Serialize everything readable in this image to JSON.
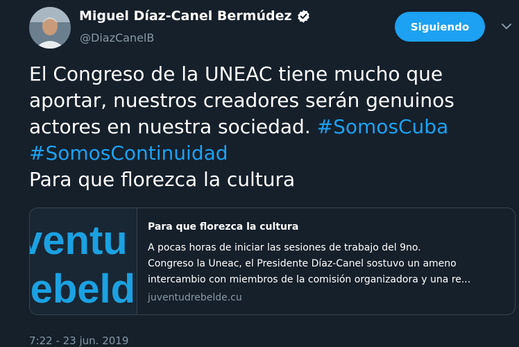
{
  "author": {
    "name": "Miguel Díaz-Canel Bermúdez",
    "handle": "@DiazCanelB",
    "verified": true
  },
  "follow_button": {
    "label": "Siguiendo"
  },
  "tweet": {
    "lines": [
      [
        {
          "text": "El Congreso de  la UNEAC tiene mucho que",
          "hashtag": false
        }
      ],
      [
        {
          "text": "aportar, nuestros creadores serán genuinos",
          "hashtag": false
        }
      ],
      [
        {
          "text": "actores en nuestra sociedad. ",
          "hashtag": false
        },
        {
          "text": "#SomosCuba",
          "hashtag": true
        }
      ],
      [
        {
          "text": "#SomosContinuidad",
          "hashtag": true
        }
      ],
      [
        {
          "text": "Para que florezca la cultura",
          "hashtag": false
        }
      ]
    ]
  },
  "link_card": {
    "thumbnail_text": [
      "ventu",
      "rebeld"
    ],
    "title": "Para que florezca la cultura",
    "description_lines": [
      "A pocas horas de iniciar las sesiones de trabajo del 9no.",
      "Congreso la Uneac, el Presidente Díaz-Canel sostuvo un ameno",
      "intercambio con miembros de la comisión organizadora y una re..."
    ],
    "domain": "juventudrebelde.cu"
  },
  "timestamp": "7:22 - 23 jun. 2019",
  "colors": {
    "background": "#15202b",
    "accent": "#1da1f2",
    "secondary_text": "#8899a6",
    "border": "#38444d",
    "thumb_text": "#1ba1e2"
  },
  "icons": {
    "verified": "verified-badge-icon",
    "caret": "chevron-down-icon"
  }
}
